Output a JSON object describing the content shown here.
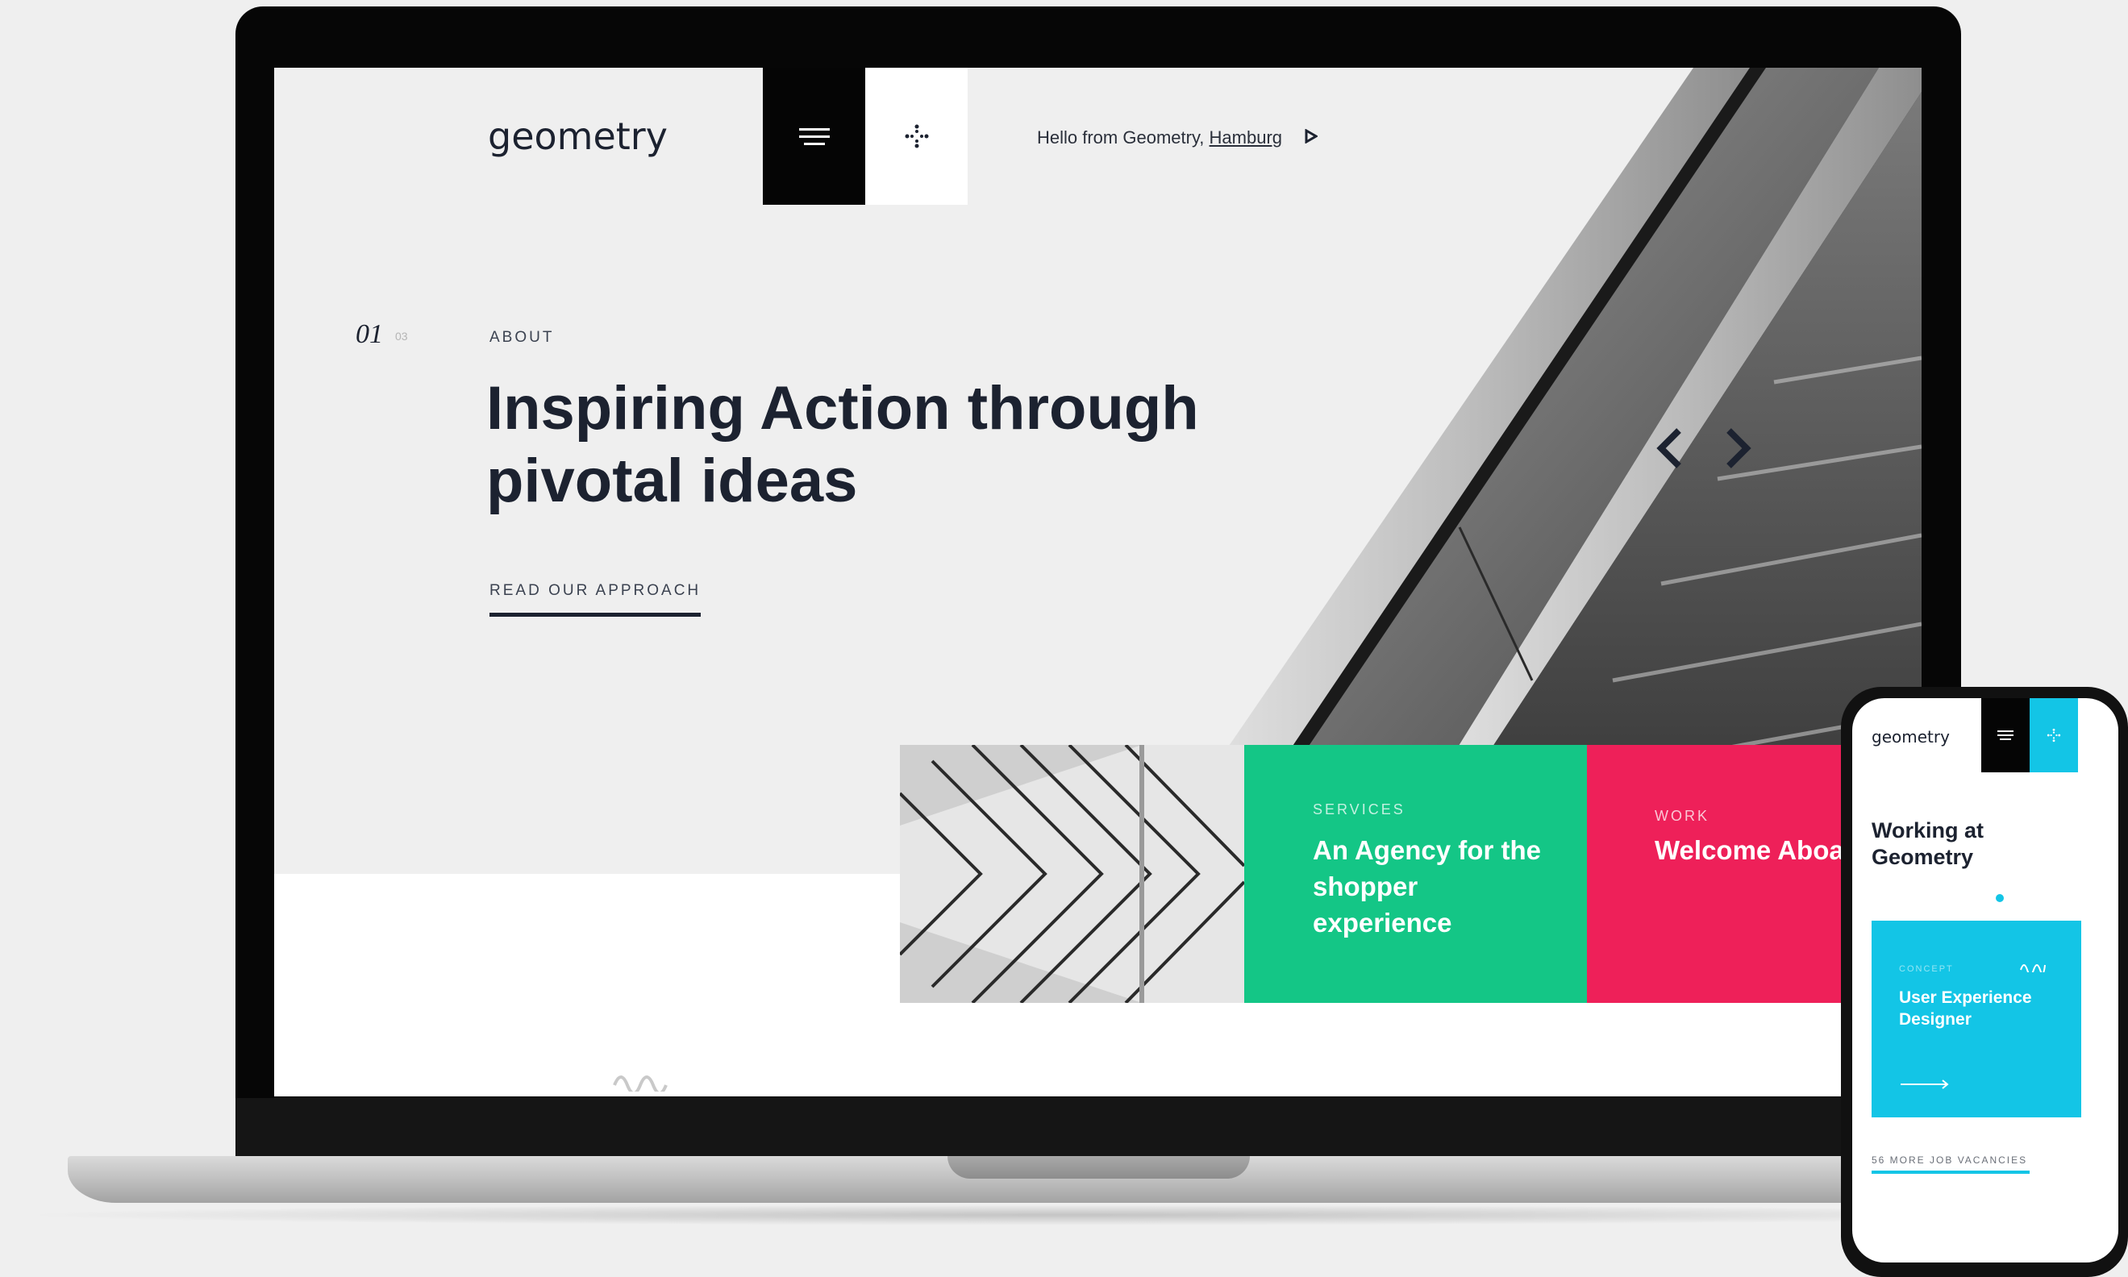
{
  "site": {
    "logo": "geometry",
    "greeting_prefix": "Hello from Geometry,",
    "greeting_city": "Hamburg"
  },
  "hero": {
    "slide_current": "01",
    "slide_total": "03",
    "eyebrow": "ABOUT",
    "headline": "Inspiring Action through pivotal ideas",
    "cta": "READ OUR APPROACH"
  },
  "tiles": [
    {
      "eyebrow": "SERVICES",
      "title": "An Agency for the shopper experience",
      "color": "#14c686"
    },
    {
      "eyebrow": "WORK",
      "title": "Welcome Aboard",
      "color": "#ee2059"
    }
  ],
  "mobile": {
    "logo": "geometry",
    "title": "Working at Geometry",
    "card": {
      "eyebrow": "CONCEPT",
      "title": "User Experience Designer",
      "color": "#13c5e6"
    },
    "link": "56 MORE JOB VACANCIES"
  },
  "icons": [
    "menu-icon",
    "dots-cross-icon",
    "play-icon",
    "chevron-left-icon",
    "chevron-right-icon",
    "wave-icon",
    "arrow-right-icon"
  ]
}
